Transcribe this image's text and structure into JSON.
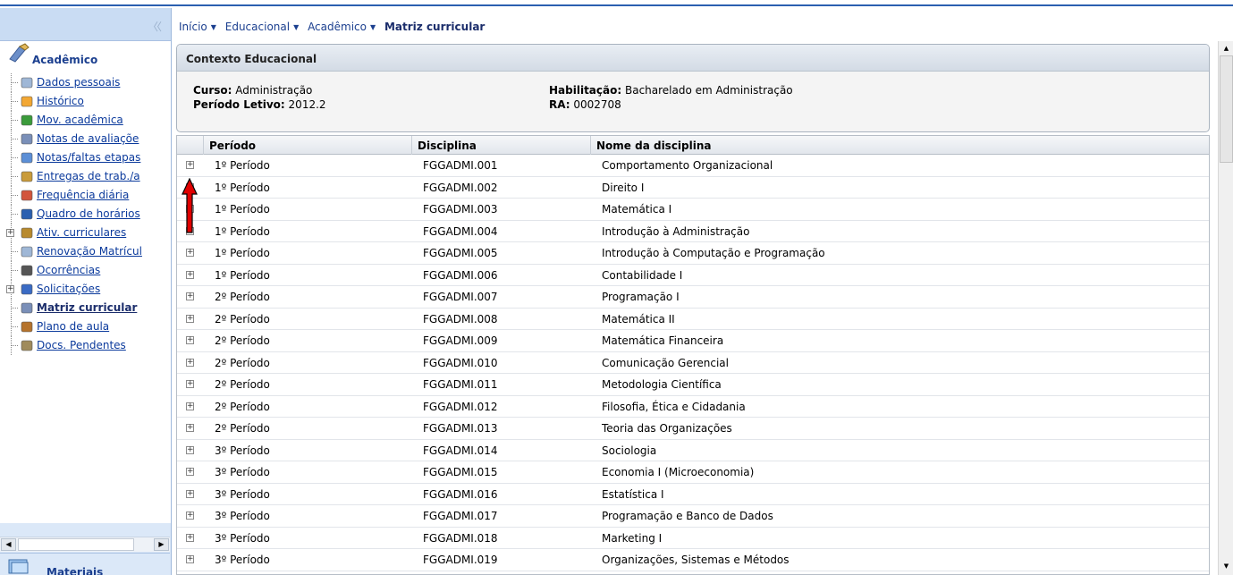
{
  "breadcrumb": [
    {
      "label": "Início"
    },
    {
      "label": "Educacional"
    },
    {
      "label": "Acadêmico"
    }
  ],
  "breadcrumb_current": "Matriz curricular",
  "sidebar": {
    "section_title": "Acadêmico",
    "items": [
      {
        "label": "Dados pessoais",
        "icon": "document-pen-icon"
      },
      {
        "label": "Histórico",
        "icon": "pencil-icon"
      },
      {
        "label": "Mov. acadêmica",
        "icon": "arrows-icon"
      },
      {
        "label": "Notas de avaliaçõe",
        "icon": "check-icon"
      },
      {
        "label": "Notas/faltas etapas",
        "icon": "table-icon"
      },
      {
        "label": "Entregas de trab./a",
        "icon": "box-icon"
      },
      {
        "label": "Frequência diária",
        "icon": "calendar-icon"
      },
      {
        "label": "Quadro de horários",
        "icon": "clock-icon"
      },
      {
        "label": "Ativ. curriculares",
        "icon": "people-icon",
        "expandable": true
      },
      {
        "label": "Renovação Matrícul",
        "icon": "document-pen-icon"
      },
      {
        "label": "Ocorrências",
        "icon": "pen-icon"
      },
      {
        "label": "Solicitações",
        "icon": "form-icon",
        "expandable": true
      },
      {
        "label": "Matriz curricular",
        "icon": "check-icon",
        "active": true
      },
      {
        "label": "Plano de aula",
        "icon": "book-icon"
      },
      {
        "label": "Docs. Pendentes",
        "icon": "documents-icon"
      }
    ],
    "bottom_section_title": "Materiais"
  },
  "context": {
    "title": "Contexto Educacional",
    "curso_label": "Curso:",
    "curso_value": " Administração",
    "periodo_label": "Período Letivo:",
    "periodo_value": " 2012.2",
    "habilitacao_label": "Habilitação:",
    "habilitacao_value": " Bacharelado em Administração",
    "ra_label": "RA:",
    "ra_value": " 0002708"
  },
  "grid": {
    "columns": [
      "Período",
      "Disciplina",
      "Nome da disciplina"
    ],
    "rows": [
      [
        "1º Período",
        "FGGADMI.001",
        "Comportamento Organizacional"
      ],
      [
        "1º Período",
        "FGGADMI.002",
        "Direito I"
      ],
      [
        "1º Período",
        "FGGADMI.003",
        "Matemática I"
      ],
      [
        "1º Período",
        "FGGADMI.004",
        "Introdução à Administração"
      ],
      [
        "1º Período",
        "FGGADMI.005",
        "Introdução à Computação e Programação"
      ],
      [
        "1º Período",
        "FGGADMI.006",
        "Contabilidade I"
      ],
      [
        "2º Período",
        "FGGADMI.007",
        "Programação I"
      ],
      [
        "2º Período",
        "FGGADMI.008",
        "Matemática II"
      ],
      [
        "2º Período",
        "FGGADMI.009",
        "Matemática Financeira"
      ],
      [
        "2º Período",
        "FGGADMI.010",
        "Comunicação Gerencial"
      ],
      [
        "2º Período",
        "FGGADMI.011",
        "Metodologia Científica"
      ],
      [
        "2º Período",
        "FGGADMI.012",
        "Filosofia, Ética e Cidadania"
      ],
      [
        "2º Período",
        "FGGADMI.013",
        "Teoria das Organizações"
      ],
      [
        "3º Período",
        "FGGADMI.014",
        "Sociologia"
      ],
      [
        "3º Período",
        "FGGADMI.015",
        "Economia I (Microeconomia)"
      ],
      [
        "3º Período",
        "FGGADMI.016",
        "Estatística I"
      ],
      [
        "3º Período",
        "FGGADMI.017",
        "Programação e Banco de Dados"
      ],
      [
        "3º Período",
        "FGGADMI.018",
        "Marketing I"
      ],
      [
        "3º Período",
        "FGGADMI.019",
        "Organizações, Sistemas e Métodos"
      ]
    ]
  },
  "colors": {
    "accent": "#1b3f8f",
    "sidebar_bg": "#dbe8f8",
    "annotation_arrow": "#e00000"
  }
}
